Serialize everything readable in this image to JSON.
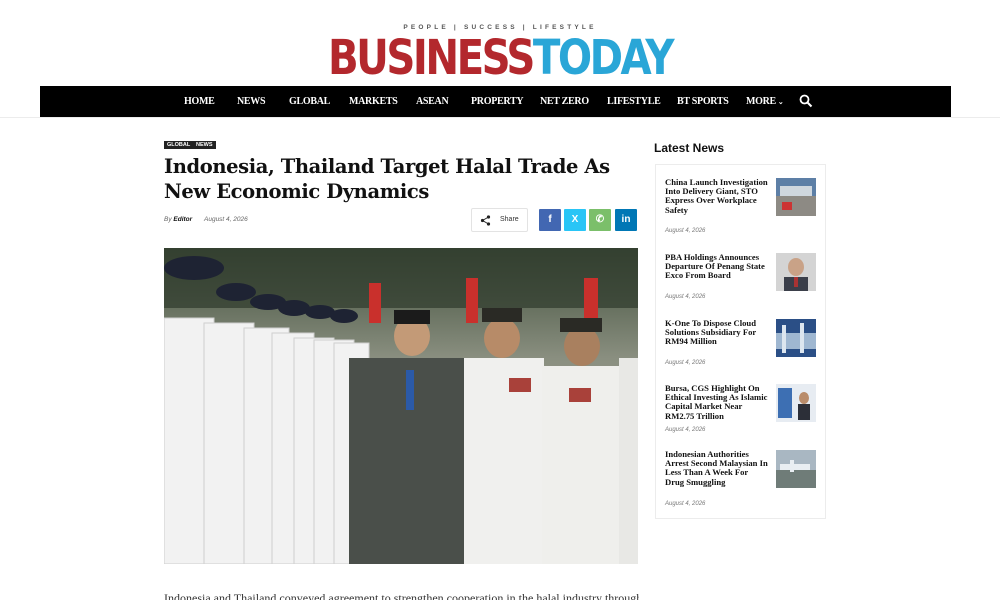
{
  "header": {
    "tagline": "PEOPLE | SUCCESS | LIFESTYLE",
    "logo_part1": "BUSINESS",
    "logo_part2": "TODAY",
    "logo_colors": {
      "business": "#b3282d",
      "today": "#2aa6d7"
    }
  },
  "nav": {
    "items": [
      "HOME",
      "NEWS",
      "GLOBAL",
      "MARKETS",
      "ASEAN",
      "PROPERTY",
      "NET ZERO",
      "LIFESTYLE",
      "BT SPORTS",
      "MORE"
    ],
    "more_chevron": "⌄",
    "search_icon": "search-icon"
  },
  "article": {
    "tags": [
      "GLOBAL",
      "NEWS"
    ],
    "title": "Indonesia, Thailand Target Halal Trade As New Economic Dynamics",
    "by_prefix": "By",
    "author": "Editor",
    "date": "August 4, 2026",
    "share_label": "Share",
    "social": {
      "facebook": "f",
      "twitter": "X",
      "whatsapp": "✆",
      "linkedin": "in"
    },
    "lede": "Indonesia and Thailand conveyed agreement to strengthen cooperation in the halal industry through"
  },
  "sidebar": {
    "title": "Latest News",
    "items": [
      {
        "title": "China Launch Investigation Into Delivery Giant, STO Express Over Workplace Safety",
        "date": "August 4, 2026"
      },
      {
        "title": "PBA Holdings Announces Departure Of Penang State Exco From Board",
        "date": "August 4, 2026"
      },
      {
        "title": "K-One To Dispose Cloud Solutions Subsidiary For RM94 Million",
        "date": "August 4, 2026"
      },
      {
        "title": "Bursa, CGS Highlight On Ethical Investing As Islamic Capital Market Near RM2.75 Trillion",
        "date": "August 4, 2026"
      },
      {
        "title": "Indonesian Authorities Arrest Second Malaysian In Less Than A Week For Drug Smuggling",
        "date": "August 4, 2026"
      }
    ]
  },
  "colors": {
    "nav_bg": "#000000",
    "facebook": "#4267b2",
    "twitter": "#29c5f6",
    "whatsapp": "#7bbf6a",
    "linkedin": "#0077b5"
  }
}
